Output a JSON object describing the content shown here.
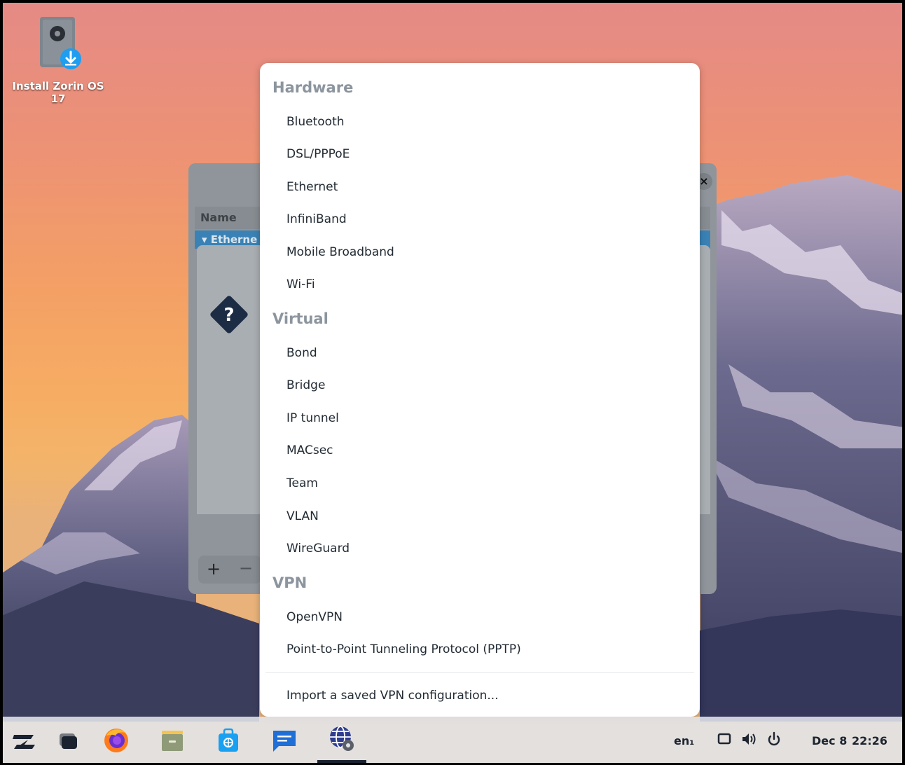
{
  "desktop": {
    "icon_label": "Install Zorin OS 17"
  },
  "background_window": {
    "close_label": "×",
    "column_header": "Name",
    "selected_row": "▾ Etherne",
    "add_label": "+",
    "remove_label": "−"
  },
  "dialog": {
    "question_glyph": "?"
  },
  "menu": {
    "hardware_title": "Hardware",
    "hardware_items": [
      "Bluetooth",
      "DSL/PPPoE",
      "Ethernet",
      "InfiniBand",
      "Mobile Broadband",
      "Wi-Fi"
    ],
    "virtual_title": "Virtual",
    "virtual_items": [
      "Bond",
      "Bridge",
      "IP tunnel",
      "MACsec",
      "Team",
      "VLAN",
      "WireGuard"
    ],
    "vpn_title": "VPN",
    "vpn_items": [
      "OpenVPN",
      "Point-to-Point Tunneling Protocol (PPTP)"
    ],
    "import_label": "Import a saved VPN configuration..."
  },
  "taskbar": {
    "keyboard_layout": "en₁",
    "date": "Dec 8",
    "time": "22:26"
  }
}
